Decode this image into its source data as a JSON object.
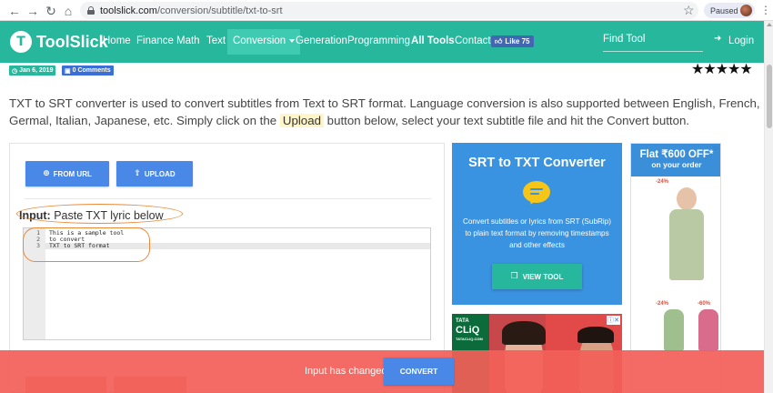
{
  "browser": {
    "url_domain": "toolslick.com",
    "url_path": "/conversion/subtitle/txt-to-srt",
    "profile_status": "Paused"
  },
  "site": {
    "logo_mark": "T",
    "logo_text": "ToolSlick",
    "nav": [
      "Home",
      "Finance",
      "Math",
      "Text",
      "Conversion",
      "Generation",
      "Programming",
      "All Tools",
      "Contact"
    ],
    "like_label": "Like 75",
    "find_tool": "Find Tool",
    "login": "Login",
    "brand_color": "#26b79d"
  },
  "meta": {
    "date": "Jan 6, 2019",
    "comments": "0 Comments",
    "rating": "★★★★★"
  },
  "description": {
    "before": "TXT to SRT converter is used to convert subtitles from Text to SRT format. Language conversion is also supported between English, French, Germal, Italian, Japanese, etc. Simply click on the ",
    "highlight": "Upload",
    "after": " button below, select your text subtitle file and hit the Convert button."
  },
  "tool": {
    "from_url": "FROM URL",
    "upload": "UPLOAD",
    "input_label_bold": "Input:",
    "input_label_rest": " Paste TXT lyric below",
    "editor_lines": [
      {
        "num": "1",
        "text": "This is a sample tool"
      },
      {
        "num": "2",
        "text": "to convert"
      },
      {
        "num": "3",
        "text": "TXT to SRT format"
      }
    ]
  },
  "ads": {
    "srt": {
      "title": "SRT to TXT Converter",
      "description": "Convert subtitles or lyrics from SRT (SubRip) to plain text format by removing timestamps and other effects",
      "button": "VIEW TOOL"
    },
    "tata": {
      "brand_top": "TATA",
      "brand": "CLiQ",
      "brand_sub": "TATACLIQ.COM"
    },
    "flat": {
      "line1": "Flat ₹600 OFF*",
      "line2": "on your order",
      "discounts": [
        "-24%",
        "-24%",
        "-60%"
      ]
    }
  },
  "notification": {
    "message": "Input has changed",
    "button": "CONVERT"
  }
}
